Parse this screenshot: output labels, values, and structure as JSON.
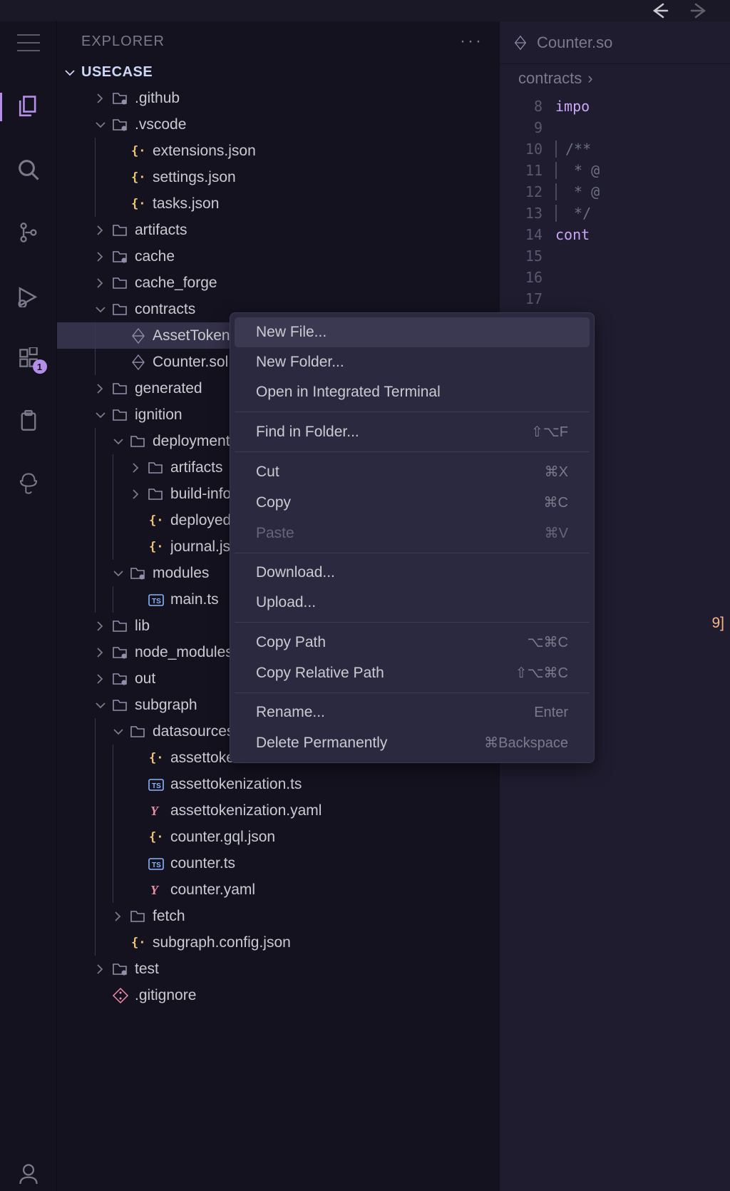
{
  "sidebar": {
    "title": "EXPLORER",
    "workspace": "USECASE"
  },
  "activity": {
    "badge_extensions": "1"
  },
  "tree": [
    {
      "depth": 0,
      "type": "folder",
      "chev": "right",
      "icon": "folder-git",
      "label": ".github"
    },
    {
      "depth": 0,
      "type": "folder",
      "chev": "down",
      "icon": "folder-vscode",
      "label": ".vscode"
    },
    {
      "depth": 1,
      "type": "file",
      "icon": "json",
      "label": "extensions.json"
    },
    {
      "depth": 1,
      "type": "file",
      "icon": "json",
      "label": "settings.json"
    },
    {
      "depth": 1,
      "type": "file",
      "icon": "json",
      "label": "tasks.json"
    },
    {
      "depth": 0,
      "type": "folder",
      "chev": "right",
      "icon": "folder",
      "label": "artifacts"
    },
    {
      "depth": 0,
      "type": "folder",
      "chev": "right",
      "icon": "folder-cache",
      "label": "cache"
    },
    {
      "depth": 0,
      "type": "folder",
      "chev": "right",
      "icon": "folder",
      "label": "cache_forge"
    },
    {
      "depth": 0,
      "type": "folder",
      "chev": "down",
      "icon": "folder",
      "label": "contracts"
    },
    {
      "depth": 1,
      "type": "file",
      "icon": "solidity",
      "label": "AssetTokeniz",
      "sel": true
    },
    {
      "depth": 1,
      "type": "file",
      "icon": "solidity",
      "label": "Counter.sol"
    },
    {
      "depth": 0,
      "type": "folder",
      "chev": "right",
      "icon": "folder",
      "label": "generated"
    },
    {
      "depth": 0,
      "type": "folder",
      "chev": "down",
      "icon": "folder",
      "label": "ignition"
    },
    {
      "depth": 1,
      "type": "folder",
      "chev": "down",
      "icon": "folder",
      "label": "deployments"
    },
    {
      "depth": 2,
      "type": "folder",
      "chev": "right",
      "icon": "folder",
      "label": "artifacts"
    },
    {
      "depth": 2,
      "type": "folder",
      "chev": "right",
      "icon": "folder",
      "label": "build-info"
    },
    {
      "depth": 2,
      "type": "file",
      "icon": "json",
      "label": "deployed_a"
    },
    {
      "depth": 2,
      "type": "file",
      "icon": "json",
      "label": "journal.json"
    },
    {
      "depth": 1,
      "type": "folder",
      "chev": "down",
      "icon": "folder-mod",
      "label": "modules"
    },
    {
      "depth": 2,
      "type": "file",
      "icon": "ts",
      "label": "main.ts"
    },
    {
      "depth": 0,
      "type": "folder",
      "chev": "right",
      "icon": "folder",
      "label": "lib"
    },
    {
      "depth": 0,
      "type": "folder",
      "chev": "right",
      "icon": "folder-node",
      "label": "node_modules"
    },
    {
      "depth": 0,
      "type": "folder",
      "chev": "right",
      "icon": "folder-out",
      "label": "out"
    },
    {
      "depth": 0,
      "type": "folder",
      "chev": "down",
      "icon": "folder",
      "label": "subgraph"
    },
    {
      "depth": 1,
      "type": "folder",
      "chev": "down",
      "icon": "folder",
      "label": "datasources"
    },
    {
      "depth": 2,
      "type": "file",
      "icon": "json",
      "label": "assettokeni"
    },
    {
      "depth": 2,
      "type": "file",
      "icon": "ts",
      "label": "assettokenization.ts"
    },
    {
      "depth": 2,
      "type": "file",
      "icon": "yaml",
      "label": "assettokenization.yaml"
    },
    {
      "depth": 2,
      "type": "file",
      "icon": "json",
      "label": "counter.gql.json"
    },
    {
      "depth": 2,
      "type": "file",
      "icon": "ts",
      "label": "counter.ts"
    },
    {
      "depth": 2,
      "type": "file",
      "icon": "yaml",
      "label": "counter.yaml"
    },
    {
      "depth": 1,
      "type": "folder",
      "chev": "right",
      "icon": "folder",
      "label": "fetch"
    },
    {
      "depth": 1,
      "type": "file",
      "icon": "json",
      "label": "subgraph.config.json"
    },
    {
      "depth": 0,
      "type": "folder",
      "chev": "right",
      "icon": "folder-test",
      "label": "test"
    },
    {
      "depth": 0,
      "type": "file",
      "icon": "git",
      "label": ".gitignore"
    }
  ],
  "editor": {
    "tab_title": "Counter.so",
    "breadcrumb": "contracts",
    "lines": [
      {
        "n": 8,
        "text": "impo",
        "kw": true
      },
      {
        "n": 9,
        "text": ""
      },
      {
        "n": 10,
        "text": "/**",
        "comment": true
      },
      {
        "n": 11,
        "text": " * @",
        "comment": true
      },
      {
        "n": 12,
        "text": " * @",
        "comment": true
      },
      {
        "n": 13,
        "text": " */",
        "comment": true
      },
      {
        "n": 14,
        "text": "cont",
        "kw": true
      },
      {
        "n": 15,
        "text": ""
      },
      {
        "n": 16,
        "text": ""
      },
      {
        "n": 17,
        "text": ""
      }
    ],
    "stray_bracket": "9]"
  },
  "context_menu": [
    {
      "label": "New File...",
      "hover": true
    },
    {
      "label": "New Folder..."
    },
    {
      "label": "Open in Integrated Terminal"
    },
    {
      "sep": true
    },
    {
      "label": "Find in Folder...",
      "shortcut": "⇧⌥F"
    },
    {
      "sep": true
    },
    {
      "label": "Cut",
      "shortcut": "⌘X"
    },
    {
      "label": "Copy",
      "shortcut": "⌘C"
    },
    {
      "label": "Paste",
      "shortcut": "⌘V",
      "disabled": true
    },
    {
      "sep": true
    },
    {
      "label": "Download..."
    },
    {
      "label": "Upload..."
    },
    {
      "sep": true
    },
    {
      "label": "Copy Path",
      "shortcut": "⌥⌘C"
    },
    {
      "label": "Copy Relative Path",
      "shortcut": "⇧⌥⌘C"
    },
    {
      "sep": true
    },
    {
      "label": "Rename...",
      "shortcut": "Enter"
    },
    {
      "label": "Delete Permanently",
      "shortcut": "⌘Backspace"
    }
  ]
}
